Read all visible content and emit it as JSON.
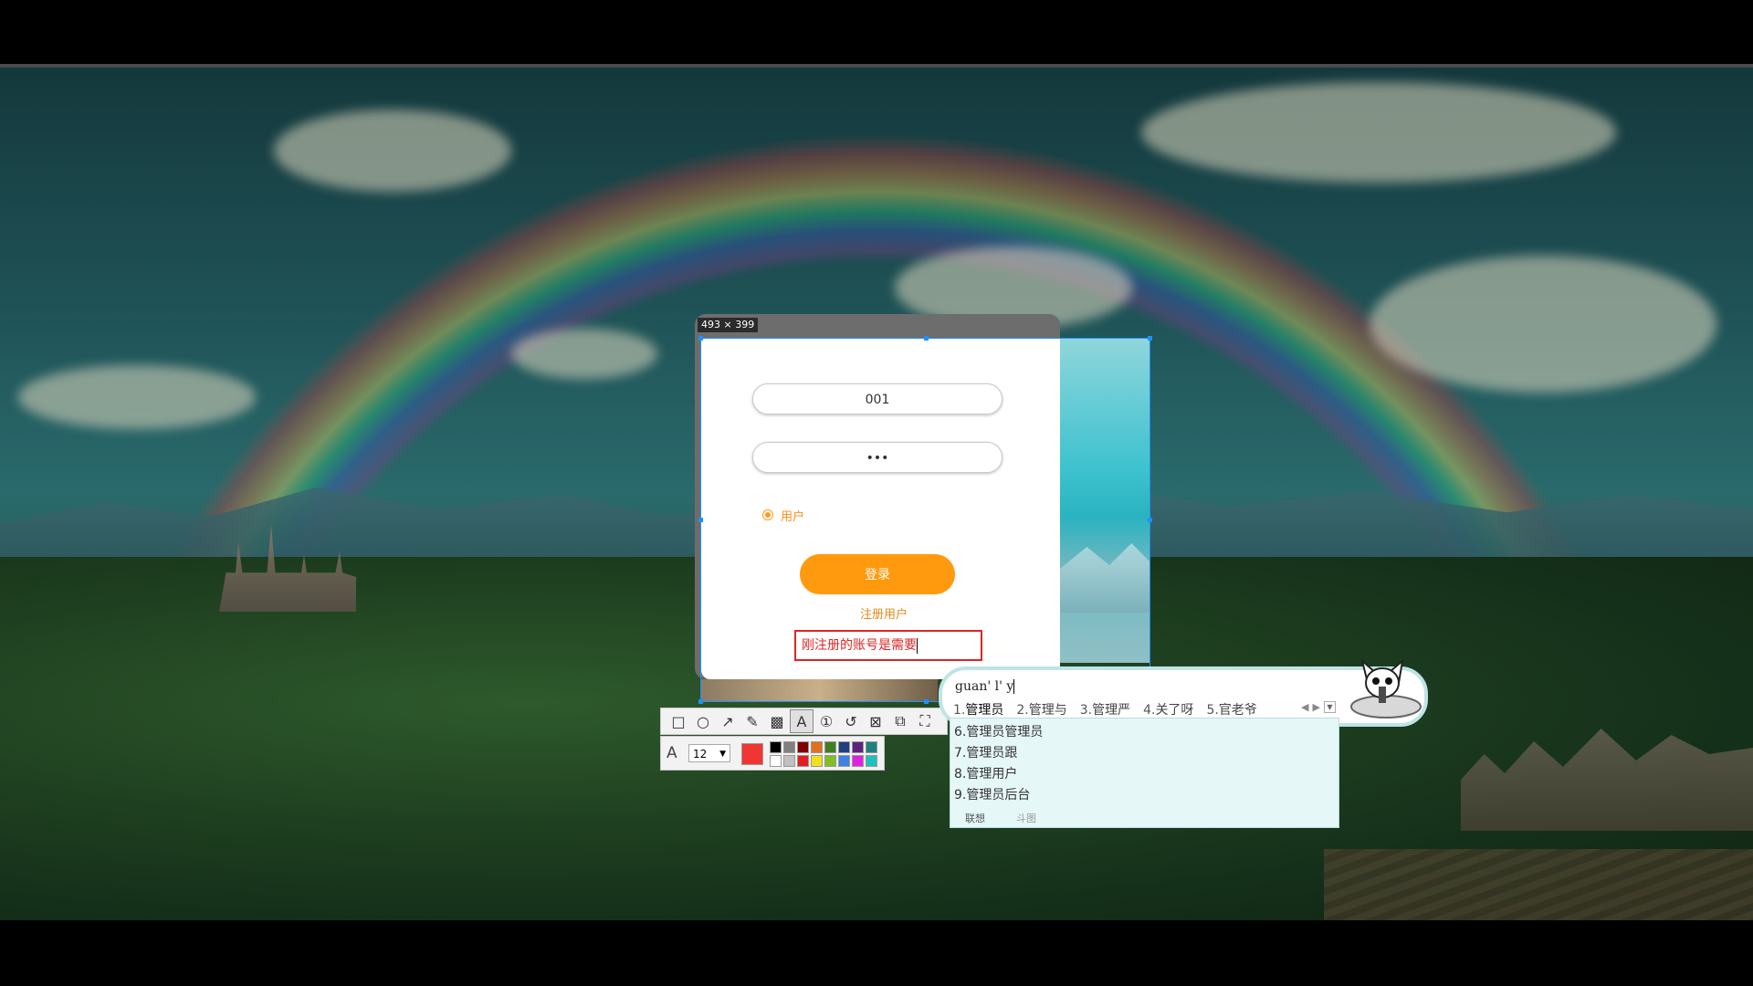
{
  "capture": {
    "size_label": "493 × 399"
  },
  "login": {
    "username_value": "001",
    "password_value": "•••",
    "role_label": "用户",
    "login_button": "登录",
    "register_link": "注册用户",
    "annotation_text": "刚注册的账号是需要"
  },
  "toolbar": {
    "tools": [
      "rectangle-icon",
      "ellipse-icon",
      "arrow-icon",
      "pencil-icon",
      "mosaic-icon",
      "text-icon",
      "sequence-number-icon",
      "undo-icon",
      "pin-icon",
      "translate-icon",
      "ocr-icon"
    ],
    "active_tool": "text-icon",
    "font_size": "12",
    "current_color": "#f03535",
    "palette": [
      "#000000",
      "#808080",
      "#800000",
      "#e07020",
      "#408020",
      "#204080",
      "#602080",
      "#208080",
      "#ffffff",
      "#c0c0c0",
      "#e02020",
      "#f0e020",
      "#80c020",
      "#4080e0",
      "#e020e0",
      "#20c0c0"
    ]
  },
  "ime": {
    "pinyin": "guan' l' y",
    "candidates_row": [
      {
        "num": "1.",
        "text": "管理员"
      },
      {
        "num": "2.",
        "text": "管理与"
      },
      {
        "num": "3.",
        "text": "管理严"
      },
      {
        "num": "4.",
        "text": "关了呀"
      },
      {
        "num": "5.",
        "text": "官老爷"
      }
    ],
    "candidates_list": [
      {
        "num": "6.",
        "text": "管理员管理员"
      },
      {
        "num": "7.",
        "text": "管理员跟"
      },
      {
        "num": "8.",
        "text": "管理用户"
      },
      {
        "num": "9.",
        "text": "管理员后台"
      }
    ],
    "footer": {
      "suggest": "联想",
      "meme": "斗图"
    }
  }
}
